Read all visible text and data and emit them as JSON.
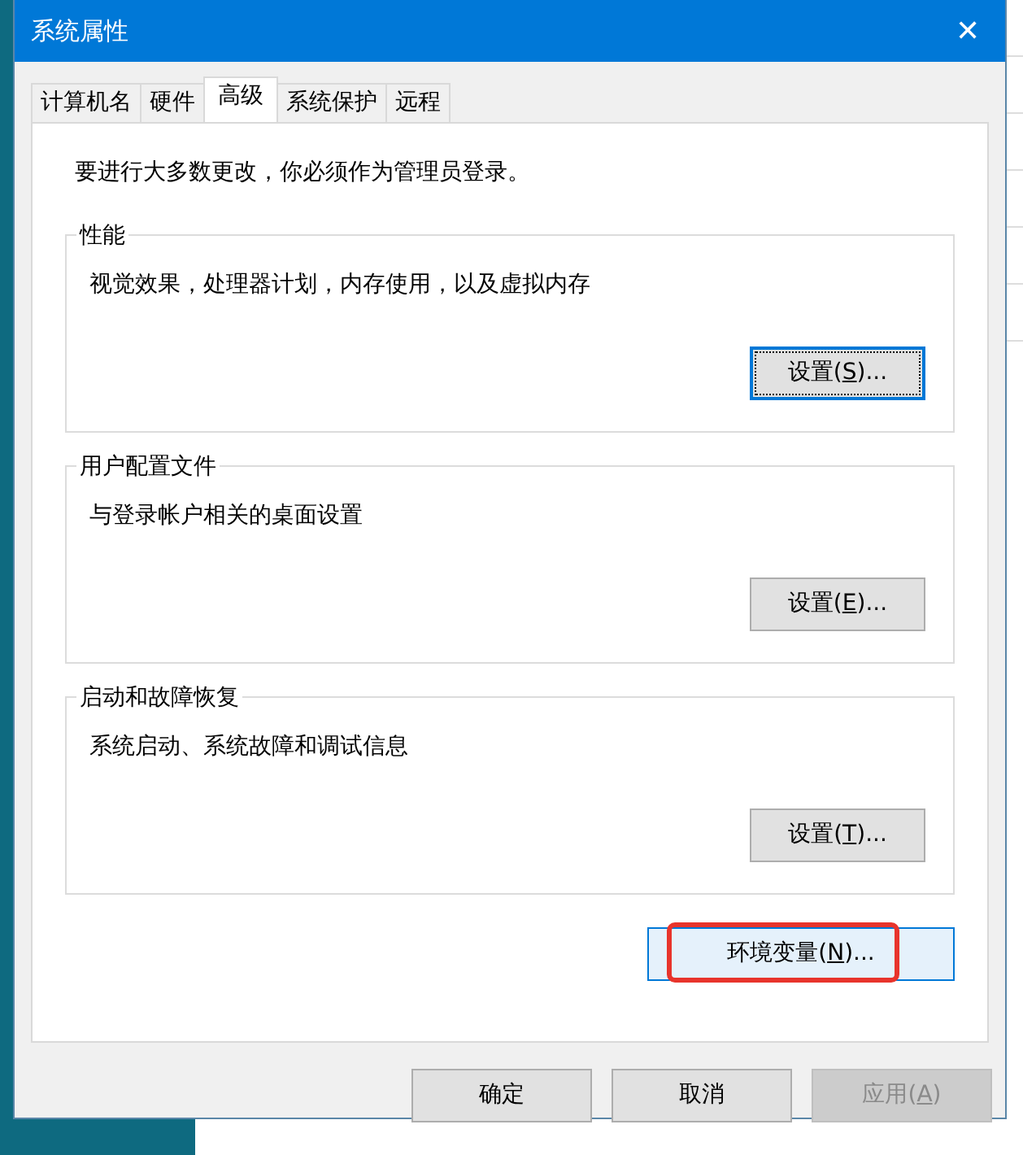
{
  "window": {
    "title": "系统属性",
    "close": "✕"
  },
  "tabs": [
    {
      "label": "计算机名",
      "selected": false
    },
    {
      "label": "硬件",
      "selected": false
    },
    {
      "label": "高级",
      "selected": true
    },
    {
      "label": "系统保护",
      "selected": false
    },
    {
      "label": "远程",
      "selected": false
    }
  ],
  "notice": "要进行大多数更改，你必须作为管理员登录。",
  "groups": [
    {
      "title": "性能",
      "description": "视觉效果，处理器计划，内存使用，以及虚拟内存",
      "button": {
        "label": "设置(**S**)...",
        "focused": true
      }
    },
    {
      "title": "用户配置文件",
      "description": "与登录帐户相关的桌面设置",
      "button": {
        "label": "设置(**E**)...",
        "focused": false
      }
    },
    {
      "title": "启动和故障恢复",
      "description": "系统启动、系统故障和调试信息",
      "button": {
        "label": "设置(**T**)...",
        "focused": false
      }
    }
  ],
  "env_button": {
    "label": "环境变量(**N**)...",
    "hovered": true,
    "annotated": true
  },
  "footer_buttons": [
    {
      "label": "确定",
      "disabled": false
    },
    {
      "label": "取消",
      "disabled": false
    },
    {
      "label": "应用(**A**)",
      "disabled": true
    }
  ]
}
